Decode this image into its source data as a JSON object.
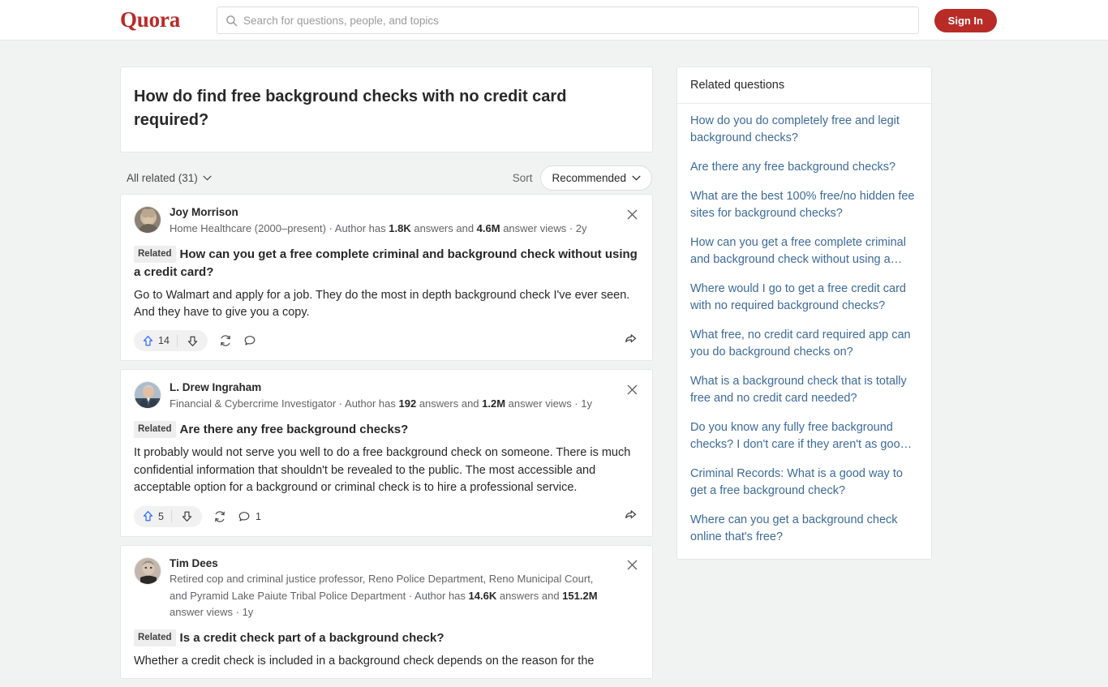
{
  "header": {
    "brand": "Quora",
    "search_placeholder": "Search for questions, people, and topics",
    "search_value": "",
    "signin_label": "Sign In"
  },
  "question": {
    "title": "How do find free background checks with no credit card required?"
  },
  "filter_bar": {
    "all_related_label": "All related (31)",
    "sort_label": "Sort",
    "sort_value": "Recommended"
  },
  "answers": [
    {
      "author": "Joy Morrison",
      "credential_prefix": "Home Healthcare (2000–present) · Author has ",
      "answers_count": "1.8K",
      "credential_mid": " answers and ",
      "views_count": "4.6M",
      "credential_suffix": " answer views · 2y",
      "related_badge": "Related",
      "question": "How can you get a free complete criminal and background check without using a credit card?",
      "body": "Go to Walmart and apply for a job. They do the most in depth background check I've ever seen. And they have to give you a copy.",
      "upvotes": "14",
      "comments": ""
    },
    {
      "author": "L. Drew Ingraham",
      "credential_prefix": "Financial & Cybercrime Investigator · Author has ",
      "answers_count": "192",
      "credential_mid": " answers and ",
      "views_count": "1.2M",
      "credential_suffix": " answer views · 1y",
      "related_badge": "Related",
      "question": "Are there any free background checks?",
      "body": "It probably would not serve you well to do a free background check on someone. There is much confidential information that shouldn't be revealed to the public. The most accessible and acceptable option for a background or criminal check is to hire a professional service.",
      "upvotes": "5",
      "comments": "1"
    },
    {
      "author": "Tim Dees",
      "credential_prefix": "Retired cop and criminal justice professor, Reno Police Department, Reno Municipal Court, and Pyramid Lake Paiute Tribal Police Department · Author has ",
      "answers_count": "14.6K",
      "credential_mid": " answers and ",
      "views_count": "151.2M",
      "credential_suffix": " answer views · 1y",
      "related_badge": "Related",
      "question": "Is a credit check part of a background check?",
      "body": "Whether a credit check is included in a background check depends on the reason for the",
      "upvotes": "",
      "comments": ""
    }
  ],
  "sidebar": {
    "title": "Related questions",
    "links": [
      "How do you do completely free and legit background checks?",
      "Are there any free background checks?",
      "What are the best 100% free/no hidden fee sites for background checks?",
      "How can you get a free complete criminal and background check without using a…",
      "Where would I go to get a free credit card with no required background checks?",
      "What free, no credit card required app can you do background checks on?",
      "What is a background check that is totally free and no credit card needed?",
      "Do you know any fully free background checks? I don't care if they aren't as goo…",
      "Criminal Records: What is a good way to get a free background check?",
      "Where can you get a background check online that's free?"
    ]
  },
  "colors": {
    "brand_red": "#b92b27",
    "link_blue": "#3d6b99",
    "upvote_blue": "#2e69ff",
    "page_bg": "#f1f2f2"
  }
}
